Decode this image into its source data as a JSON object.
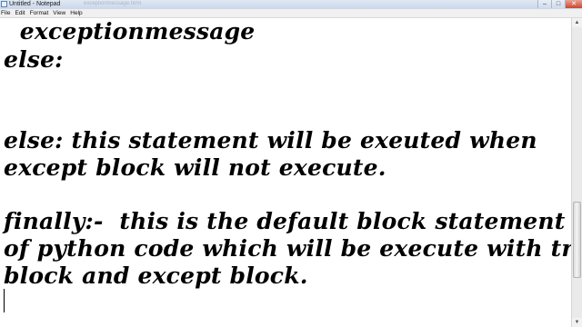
{
  "window": {
    "title": "Untitled - Notepad",
    "faded_tab": "exceptionmessage.html",
    "controls": {
      "minimize": "–",
      "maximize": "□",
      "close": "✕"
    }
  },
  "menu": {
    "items": [
      "File",
      "Edit",
      "Format",
      "View",
      "Help"
    ]
  },
  "editor": {
    "lines": [
      "  exceptionmessage",
      "else:",
      "",
      "",
      "else: this statement will be exeuted when",
      "except block will not execute.",
      "",
      "finally:-  this is the default block statement",
      "of python code which will be execute with try",
      "block and except block."
    ]
  },
  "scrollbar": {
    "up_arrow": "▲",
    "down_arrow": "▼"
  }
}
